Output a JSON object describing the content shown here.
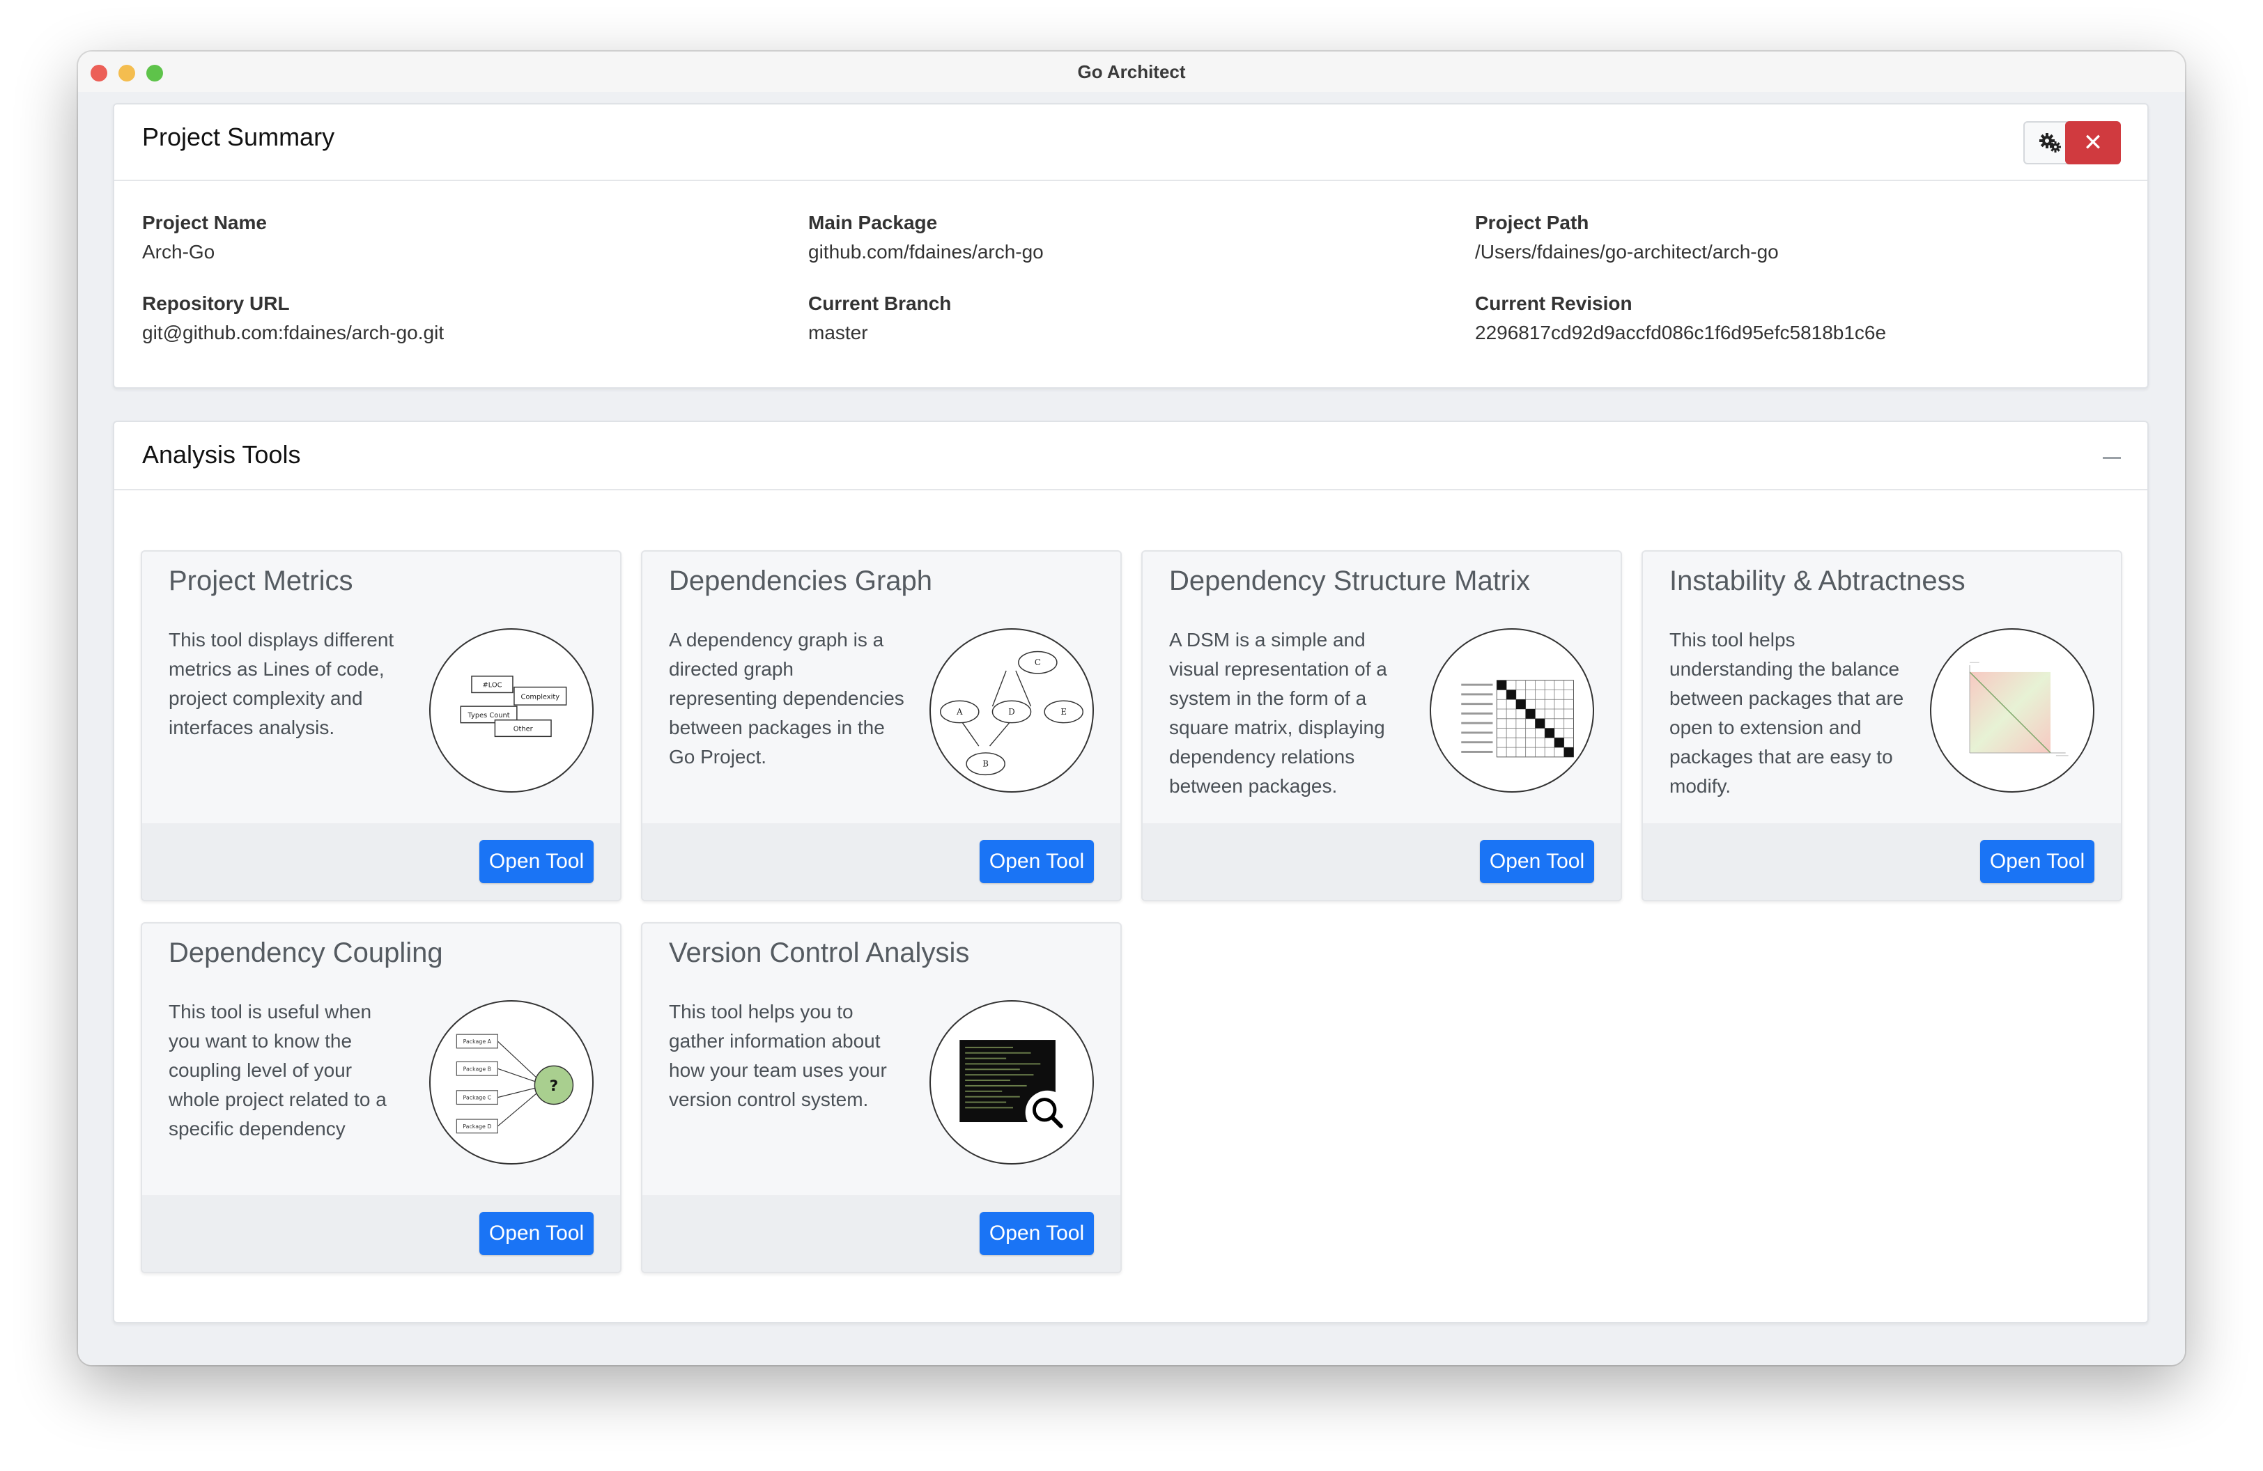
{
  "window": {
    "title": "Go Architect"
  },
  "summary": {
    "title": "Project Summary",
    "close_label": "✕",
    "fields": [
      {
        "label": "Project Name",
        "value": "Arch-Go"
      },
      {
        "label": "Main Package",
        "value": "github.com/fdaines/arch-go"
      },
      {
        "label": "Project Path",
        "value": "/Users/fdaines/go-architect/arch-go"
      },
      {
        "label": "Repository URL",
        "value": "git@github.com:fdaines/arch-go.git"
      },
      {
        "label": "Current Branch",
        "value": "master"
      },
      {
        "label": "Current Revision",
        "value": "2296817cd92d9accfd086c1f6d95efc5818b1c6e"
      }
    ]
  },
  "analysis": {
    "title": "Analysis Tools",
    "tools": [
      {
        "title": "Project Metrics",
        "description": "This tool displays different metrics as Lines of code, project complexity and interfaces analysis.",
        "button": "Open Tool",
        "image_labels": [
          "#LOC",
          "Complexity",
          "Types Count",
          "Other"
        ]
      },
      {
        "title": "Dependencies Graph",
        "description": "A dependency graph is a directed graph representing dependencies between packages in the Go Project.",
        "button": "Open Tool",
        "image_labels": [
          "C",
          "A",
          "D",
          "E",
          "B"
        ]
      },
      {
        "title": "Dependency Structure Matrix",
        "description": "A DSM is a simple and visual representation of a system in the form of a square matrix, displaying dependency relations between packages.",
        "button": "Open Tool",
        "image_labels": []
      },
      {
        "title": "Instability & Abtractness",
        "description": "This tool helps understanding the balance between packages that are open to extension and packages that are easy to modify.",
        "button": "Open Tool",
        "image_labels": []
      },
      {
        "title": "Dependency Coupling",
        "description": "This tool is useful when you want to know the coupling level of your whole project related to a specific dependency",
        "button": "Open Tool",
        "image_labels": [
          "Package A",
          "Package B",
          "Package C",
          "Package D",
          "?"
        ]
      },
      {
        "title": "Version Control Analysis",
        "description": "This tool helps you to gather information about how your team uses your version control system.",
        "button": "Open Tool",
        "image_labels": []
      }
    ]
  },
  "colors": {
    "primary": "#1a74f5",
    "danger": "#d03a3f",
    "background": "#eef0f3"
  },
  "icons": {
    "settings": "gears-icon",
    "close": "close-icon",
    "collapse": "minus-icon"
  }
}
